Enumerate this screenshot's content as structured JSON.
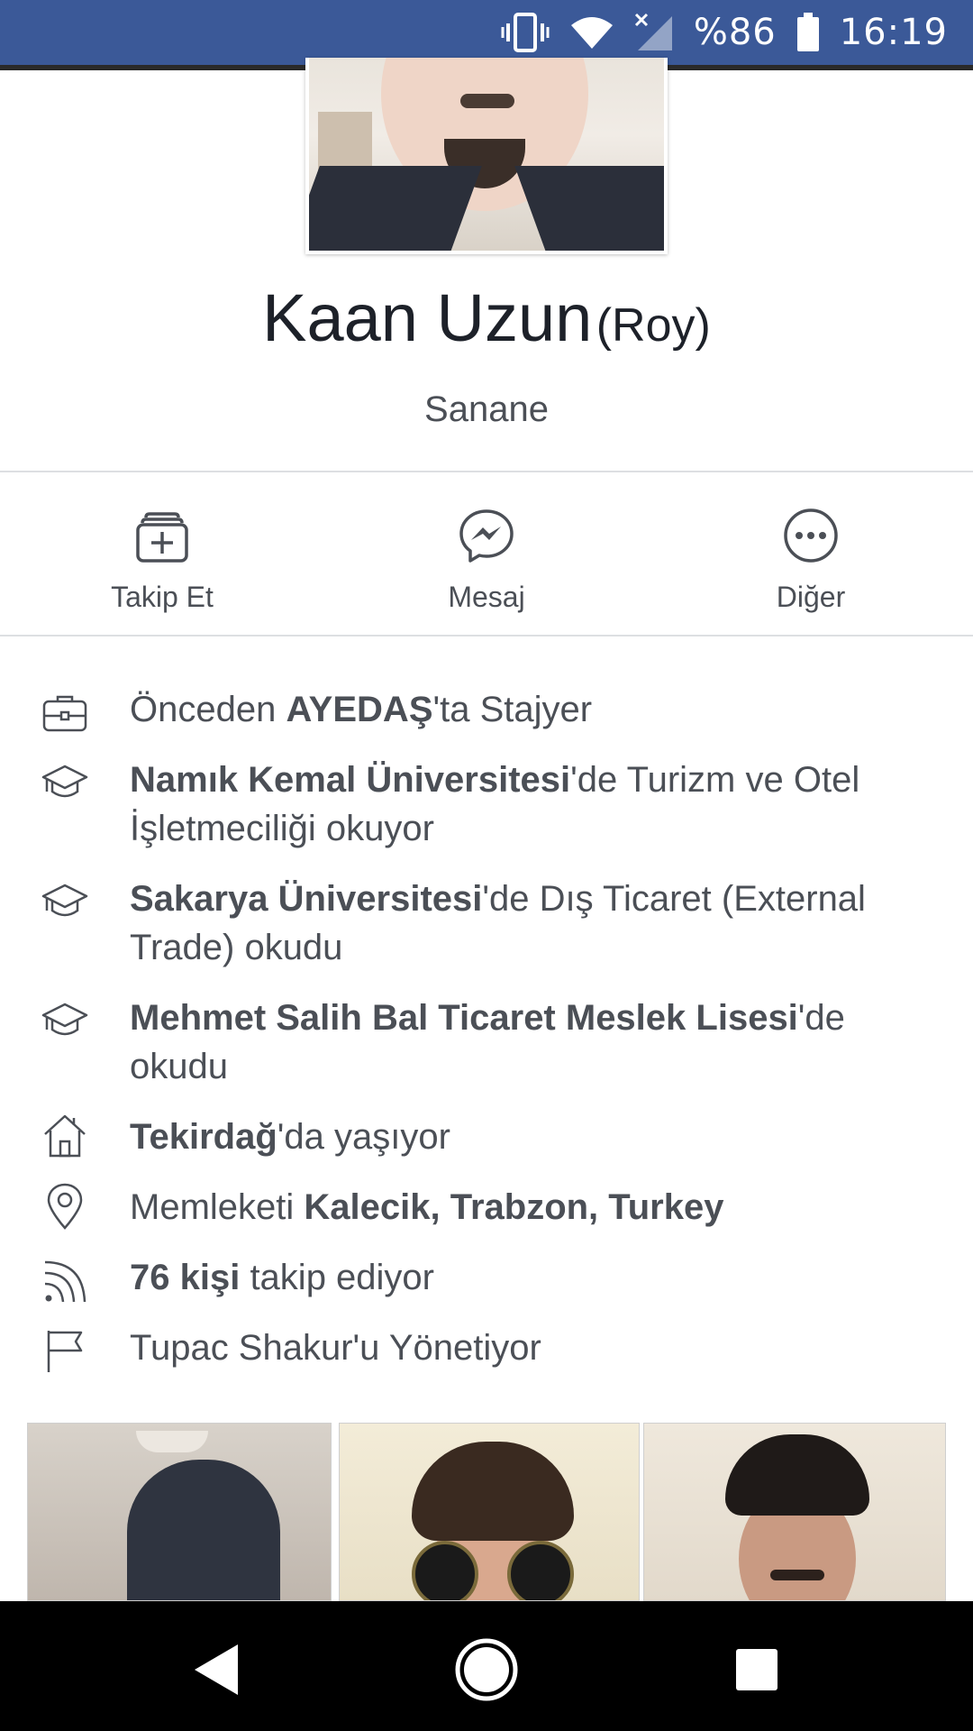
{
  "status_bar": {
    "battery": "%86",
    "time": "16:19",
    "icons": [
      "vibrate-icon",
      "wifi-icon",
      "signal-icon",
      "battery-icon"
    ]
  },
  "profile": {
    "name": "Kaan Uzun",
    "alternate_name": "(Roy)",
    "tagline": "Sanane"
  },
  "actions": [
    {
      "label": "Takip Et",
      "icon": "follow-icon"
    },
    {
      "label": "Mesaj",
      "icon": "messenger-icon"
    },
    {
      "label": "Diğer",
      "icon": "more-icon"
    }
  ],
  "info": {
    "work": {
      "pre": "Önceden ",
      "bold": "AYEDAŞ",
      "post": "'ta Stajyer",
      "icon": "briefcase-icon"
    },
    "edu1": {
      "pre": "",
      "bold": "Namık Kemal Üniversitesi",
      "post": "'de Turizm ve Otel İşletmeciliği okuyor",
      "icon": "graduation-cap-icon"
    },
    "edu2": {
      "pre": "",
      "bold": "Sakarya Üniversitesi",
      "post": "'de Dış Ticaret (External Trade) okudu",
      "icon": "graduation-cap-icon"
    },
    "edu3": {
      "pre": "",
      "bold": "Mehmet Salih Bal Ticaret Meslek Lisesi",
      "post": "'de okudu",
      "icon": "graduation-cap-icon"
    },
    "lives": {
      "pre": "",
      "bold": "Tekirdağ",
      "post": "'da yaşıyor",
      "icon": "home-icon"
    },
    "from": {
      "pre": "Memleketi ",
      "bold": "Kalecik, Trabzon, Turkey",
      "post": "",
      "icon": "location-pin-icon"
    },
    "followers": {
      "pre": "",
      "bold": "76 kişi",
      "post": " takip ediyor",
      "icon": "rss-icon"
    },
    "manages": {
      "pre": "Tupac Shakur'u Yönetiyor",
      "bold": "",
      "post": "",
      "icon": "flag-icon"
    }
  },
  "navigation": {
    "icons": [
      "back-icon",
      "home-button-icon",
      "recents-icon"
    ]
  },
  "colors": {
    "status_bar": "#3b5998",
    "text_primary": "#1d2129",
    "text_secondary": "#4b4f56",
    "divider": "#dddfe2"
  }
}
